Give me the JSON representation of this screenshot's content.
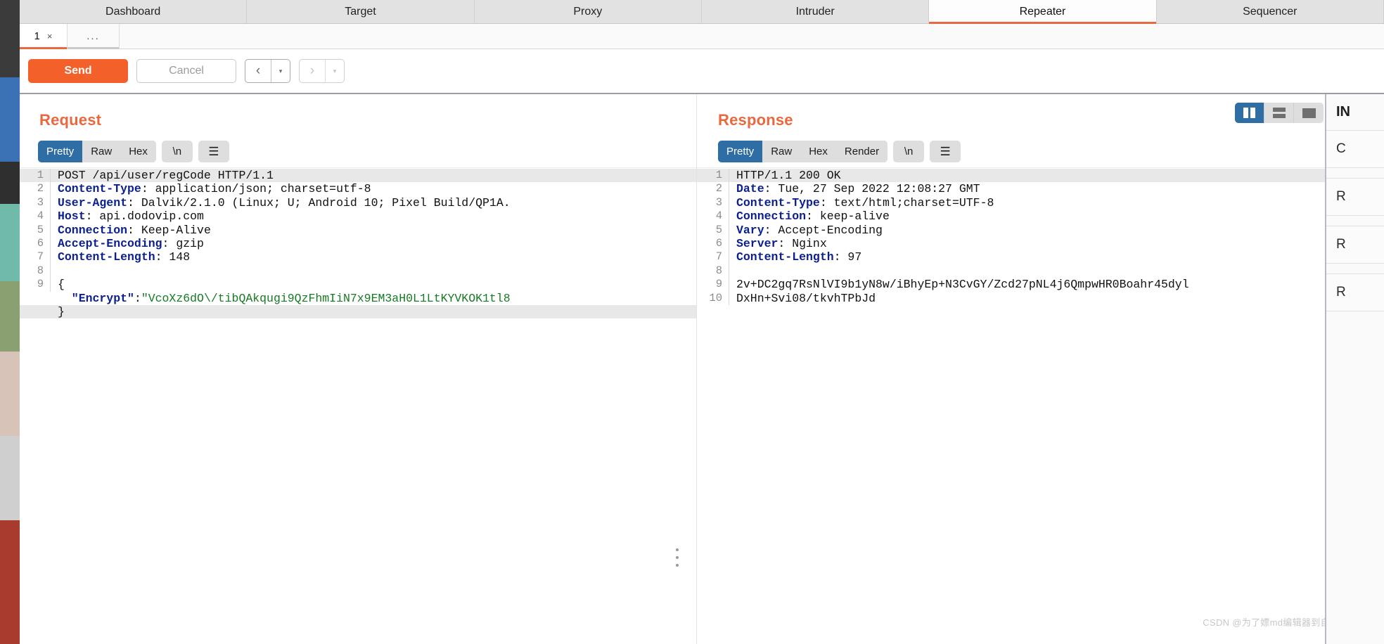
{
  "app": {
    "name": "Burp Suite Repeater"
  },
  "main_tabs": [
    {
      "label": "Dashboard",
      "active": false
    },
    {
      "label": "Target",
      "active": false
    },
    {
      "label": "Proxy",
      "active": false
    },
    {
      "label": "Intruder",
      "active": false
    },
    {
      "label": "Repeater",
      "active": true
    },
    {
      "label": "Sequencer",
      "active": false
    }
  ],
  "sub_tabs": {
    "items": [
      {
        "number": "1",
        "close": "×",
        "active": true
      }
    ],
    "add_label": "..."
  },
  "action_bar": {
    "send_label": "Send",
    "cancel_label": "Cancel",
    "back_glyph": "‹",
    "back_caret": "▾",
    "forward_glyph": "›",
    "forward_caret": "▾"
  },
  "view_toggle": {
    "options": [
      {
        "name": "side-by-side",
        "active": true
      },
      {
        "name": "stacked",
        "active": false
      },
      {
        "name": "single",
        "active": false
      }
    ]
  },
  "request": {
    "title": "Request",
    "tabs": [
      {
        "label": "Pretty",
        "active": true
      },
      {
        "label": "Raw",
        "active": false
      },
      {
        "label": "Hex",
        "active": false
      }
    ],
    "newline_label": "\\n",
    "menu_label": "☰",
    "lines": [
      {
        "n": "1",
        "parts": [
          {
            "t": "POST /api/user/regCode HTTP/1.1",
            "c": "k-plain"
          }
        ],
        "hl": true
      },
      {
        "n": "2",
        "parts": [
          {
            "t": "Content-Type",
            "c": "k-hdr"
          },
          {
            "t": ": application/json; charset=utf-8",
            "c": "k-plain"
          }
        ],
        "hl": false
      },
      {
        "n": "3",
        "parts": [
          {
            "t": "User-Agent",
            "c": "k-hdr"
          },
          {
            "t": ": Dalvik/2.1.0 (Linux; U; Android 10; Pixel Build/QP1A.",
            "c": "k-plain"
          }
        ],
        "hl": false
      },
      {
        "n": "4",
        "parts": [
          {
            "t": "Host",
            "c": "k-hdr"
          },
          {
            "t": ": api.dodovip.com",
            "c": "k-plain"
          }
        ],
        "hl": false
      },
      {
        "n": "5",
        "parts": [
          {
            "t": "Connection",
            "c": "k-hdr"
          },
          {
            "t": ": Keep-Alive",
            "c": "k-plain"
          }
        ],
        "hl": false
      },
      {
        "n": "6",
        "parts": [
          {
            "t": "Accept-Encoding",
            "c": "k-hdr"
          },
          {
            "t": ": gzip",
            "c": "k-plain"
          }
        ],
        "hl": false
      },
      {
        "n": "7",
        "parts": [
          {
            "t": "Content-Length",
            "c": "k-hdr"
          },
          {
            "t": ": 148",
            "c": "k-plain"
          }
        ],
        "hl": false
      },
      {
        "n": "8",
        "parts": [
          {
            "t": "",
            "c": "k-plain"
          }
        ],
        "hl": false
      },
      {
        "n": "9",
        "parts": [
          {
            "t": "{",
            "c": "k-plain"
          }
        ],
        "hl": false
      },
      {
        "n": "",
        "parts": [
          {
            "t": "  \"Encrypt\"",
            "c": "k-str"
          },
          {
            "t": ":",
            "c": "k-plain"
          },
          {
            "t": "\"VcoXz6dO\\/tibQAkqugi9QzFhmIiN7x9EM3aH0L1LtKYVKOK1tl8",
            "c": "k-val"
          }
        ],
        "hl": false
      },
      {
        "n": "",
        "parts": [
          {
            "t": "}",
            "c": "k-plain"
          }
        ],
        "hl": true
      }
    ]
  },
  "response": {
    "title": "Response",
    "tabs": [
      {
        "label": "Pretty",
        "active": true
      },
      {
        "label": "Raw",
        "active": false
      },
      {
        "label": "Hex",
        "active": false
      },
      {
        "label": "Render",
        "active": false
      }
    ],
    "newline_label": "\\n",
    "menu_label": "☰",
    "lines": [
      {
        "n": "1",
        "parts": [
          {
            "t": "HTTP/1.1 200 OK",
            "c": "k-plain"
          }
        ],
        "hl": true
      },
      {
        "n": "2",
        "parts": [
          {
            "t": "Date",
            "c": "k-hdr"
          },
          {
            "t": ": Tue, 27 Sep 2022 12:08:27 GMT",
            "c": "k-plain"
          }
        ],
        "hl": false
      },
      {
        "n": "3",
        "parts": [
          {
            "t": "Content-Type",
            "c": "k-hdr"
          },
          {
            "t": ": text/html;charset=UTF-8",
            "c": "k-plain"
          }
        ],
        "hl": false
      },
      {
        "n": "4",
        "parts": [
          {
            "t": "Connection",
            "c": "k-hdr"
          },
          {
            "t": ": keep-alive",
            "c": "k-plain"
          }
        ],
        "hl": false
      },
      {
        "n": "5",
        "parts": [
          {
            "t": "Vary",
            "c": "k-hdr"
          },
          {
            "t": ": Accept-Encoding",
            "c": "k-plain"
          }
        ],
        "hl": false
      },
      {
        "n": "6",
        "parts": [
          {
            "t": "Server",
            "c": "k-hdr"
          },
          {
            "t": ": Nginx",
            "c": "k-plain"
          }
        ],
        "hl": false
      },
      {
        "n": "7",
        "parts": [
          {
            "t": "Content-Length",
            "c": "k-hdr"
          },
          {
            "t": ": 97",
            "c": "k-plain"
          }
        ],
        "hl": false
      },
      {
        "n": "8",
        "parts": [
          {
            "t": "",
            "c": "k-plain"
          }
        ],
        "hl": false
      },
      {
        "n": "9",
        "parts": [
          {
            "t": "2v+DC2gq7RsNlVI9b1yN8w/iBhyEp+N3CvGY/Zcd27pNL4j6QmpwHR0Boahr45dyl",
            "c": "k-plain"
          }
        ],
        "hl": false
      },
      {
        "n": "10",
        "parts": [
          {
            "t": "DxHn+Svi08/tkvhTPbJd",
            "c": "k-plain"
          }
        ],
        "hl": false
      }
    ]
  },
  "inspector": {
    "title": "IN",
    "rows": [
      "C",
      "R",
      "R",
      "R"
    ]
  },
  "watermark": "CSDN @为了嫖md编辑器到自己的博客",
  "colors": {
    "accent_orange": "#e8683f",
    "send_orange": "#f4602a",
    "active_blue": "#2f6ea5",
    "header_key_blue": "#0b1f8f",
    "string_green": "#157a23"
  }
}
